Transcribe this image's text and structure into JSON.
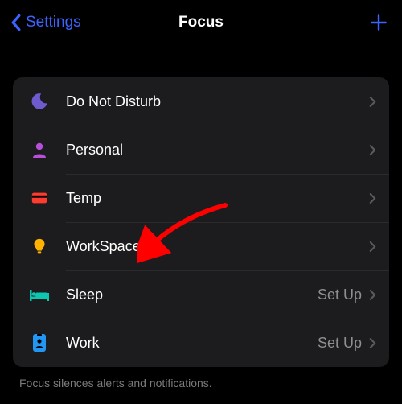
{
  "nav": {
    "back_label": "Settings",
    "title": "Focus",
    "add_label": "+"
  },
  "rows": [
    {
      "icon": "moon-icon",
      "icon_color": "#6d5bd0",
      "label": "Do Not Disturb",
      "accessory": ""
    },
    {
      "icon": "person-icon",
      "icon_color": "#b84edc",
      "label": "Personal",
      "accessory": ""
    },
    {
      "icon": "card-icon",
      "icon_color": "#ff3b30",
      "label": "Temp",
      "accessory": ""
    },
    {
      "icon": "bulb-icon",
      "icon_color": "#ffb300",
      "label": "WorkSpace",
      "accessory": ""
    },
    {
      "icon": "bed-icon",
      "icon_color": "#0dc6b0",
      "label": "Sleep",
      "accessory": "Set Up"
    },
    {
      "icon": "badge-icon",
      "icon_color": "#2196f3",
      "label": "Work",
      "accessory": "Set Up"
    }
  ],
  "footer": "Focus silences alerts and notifications.",
  "annotation": {
    "arrow_color": "#ff0000"
  }
}
